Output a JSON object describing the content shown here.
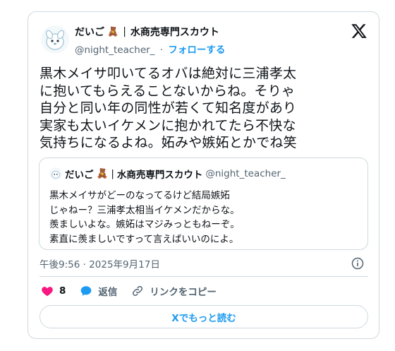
{
  "author": {
    "display_name": "だいご",
    "bear_emoji": "🧸",
    "separator": "|",
    "title": "水商売専門スカウト",
    "handle": "@night_teacher_",
    "dot": "·",
    "follow_label": "フォローする"
  },
  "tweet": {
    "text": "黒木メイサ叩いてるオバは絶対に三浦孝太\nに抱いてもらえることないからね。そりゃ\n自分と同い年の同性が若くて知名度があり\n実家も太いイケメンに抱かれてたら不快な\n気持ちになるよね。妬みや嫉妬とかでね笑"
  },
  "quote": {
    "display_name": "だいご",
    "bear_emoji": "🧸",
    "separator": "|",
    "title": "水商売専門スカウト",
    "handle": "@night_teacher_",
    "text": "黒木メイサがどーのなってるけど結局嫉妬\nじゃねー？三浦孝太相当イケメンだからな。\n羨ましいよな。嫉妬はマジみっともねーぞ。\n素直に羨ましいですって言えばいいのによ。"
  },
  "timestamp": "午後9:56 · 2025年9月17日",
  "actions": {
    "like_count": "8",
    "reply_label": "返信",
    "copy_link_label": "リンクをコピー"
  },
  "read_more_label": "Xでもっと読む",
  "icons": {
    "logo": "x-logo-icon",
    "like": "heart-icon",
    "reply": "speech-bubble-icon",
    "link": "link-icon",
    "info": "info-icon"
  },
  "colors": {
    "accent": "#1d9bf0",
    "like": "#f91880",
    "text": "#0f1419",
    "muted": "#536471",
    "border": "#cfd9de"
  }
}
